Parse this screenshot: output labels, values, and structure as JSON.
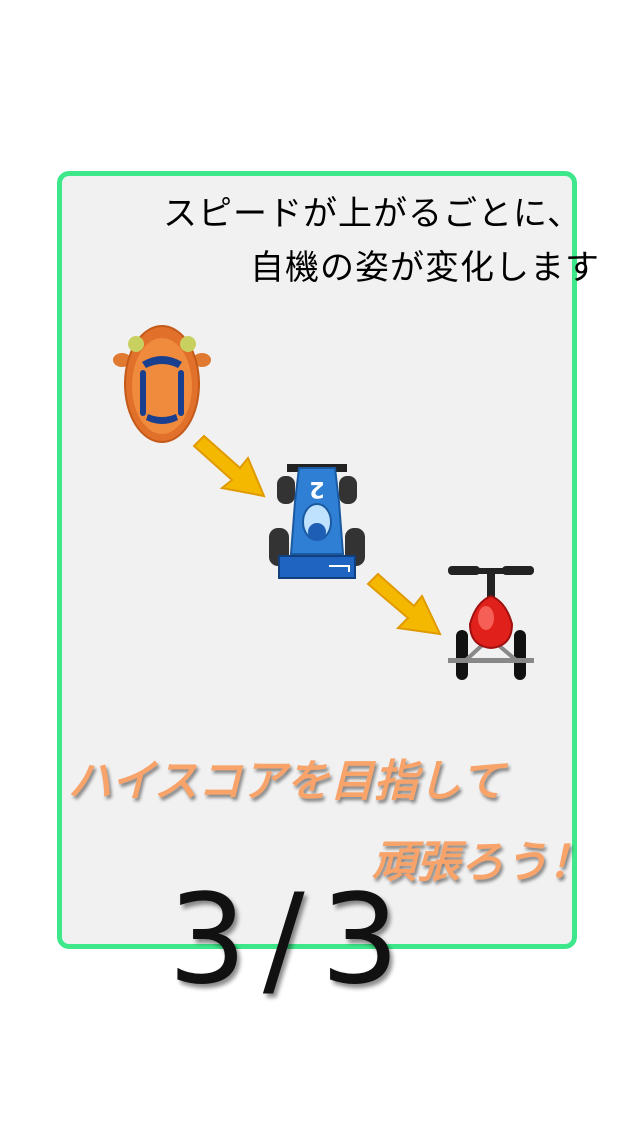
{
  "tutorial": {
    "line1": "スピードが上がるごとに、",
    "line2": "自機の姿が変化します",
    "slogan_line1": "ハイスコアを目指して",
    "slogan_line2": "頑張ろう！",
    "page_indicator": "3/3"
  },
  "vehicles": [
    {
      "name": "orange-car-icon"
    },
    {
      "name": "blue-race-car-icon",
      "number": "2"
    },
    {
      "name": "red-tricycle-icon"
    }
  ],
  "colors": {
    "card_border": "#3ee88a",
    "card_background": "#f1f1f1",
    "slogan": "#f7a36a",
    "arrow": "#f5b800"
  }
}
